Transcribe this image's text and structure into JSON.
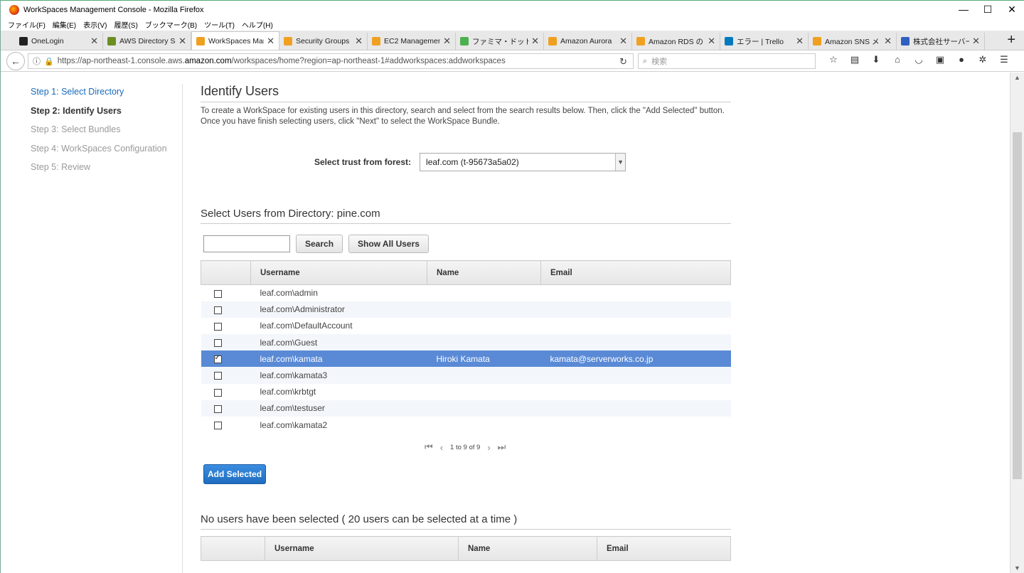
{
  "window": {
    "title": "WorkSpaces Management Console - Mozilla Firefox",
    "controls": [
      "—",
      "☐",
      "✕"
    ]
  },
  "menu": [
    "ファイル(F)",
    "編集(E)",
    "表示(V)",
    "履歴(S)",
    "ブックマーク(B)",
    "ツール(T)",
    "ヘルプ(H)"
  ],
  "tabs": [
    {
      "label": "OneLogin",
      "color": "#222222"
    },
    {
      "label": "AWS Directory Se",
      "color": "#6b8e23"
    },
    {
      "label": "WorkSpaces Man",
      "color": "#f0a020"
    },
    {
      "label": "Security Groups |",
      "color": "#f0a020"
    },
    {
      "label": "EC2 Managemen",
      "color": "#f0a020"
    },
    {
      "label": "ファミマ・ドット・コムL",
      "color": "#4cb050"
    },
    {
      "label": "Amazon Aurora",
      "color": "#f0a020"
    },
    {
      "label": "Amazon RDS の",
      "color": "#f0a020"
    },
    {
      "label": "エラー | Trello",
      "color": "#0079bf"
    },
    {
      "label": "Amazon SNS メ",
      "color": "#f0a020"
    },
    {
      "label": "株式会社サーバーワ",
      "color": "#3060c0"
    }
  ],
  "nav": {
    "url_prefix": "https://ap-northeast-1.console.aws.",
    "url_host": "amazon.com",
    "url_suffix": "/workspaces/home?region=ap-northeast-1#addworkspaces:addworkspaces",
    "search_placeholder": "検索"
  },
  "steps": [
    "Step 1: Select Directory",
    "Step 2: Identify Users",
    "Step 3: Select Bundles",
    "Step 4: WorkSpaces Configuration",
    "Step 5: Review"
  ],
  "main": {
    "title": "Identify Users",
    "description": "To create a WorkSpace for existing users in this directory, search and select from the search results below. Then, click the \"Add Selected\" button. Once you have finish selecting users, click \"Next\" to select the WorkSpace Bundle.",
    "forest_label": "Select trust from forest:",
    "forest_value": "leaf.com (t-95673a5a02)",
    "directory_heading": "Select Users from Directory: pine.com",
    "search_button": "Search",
    "show_all_button": "Show All Users",
    "columns": [
      "Username",
      "Name",
      "Email"
    ],
    "users": [
      {
        "username": "leaf.com\\admin",
        "name": "",
        "email": "",
        "checked": false
      },
      {
        "username": "leaf.com\\Administrator",
        "name": "",
        "email": "",
        "checked": false
      },
      {
        "username": "leaf.com\\DefaultAccount",
        "name": "",
        "email": "",
        "checked": false
      },
      {
        "username": "leaf.com\\Guest",
        "name": "",
        "email": "",
        "checked": false
      },
      {
        "username": "leaf.com\\kamata",
        "name": "Hiroki Kamata",
        "email": "kamata@serverworks.co.jp",
        "checked": true
      },
      {
        "username": "leaf.com\\kamata3",
        "name": "",
        "email": "",
        "checked": false
      },
      {
        "username": "leaf.com\\krbtgt",
        "name": "",
        "email": "",
        "checked": false
      },
      {
        "username": "leaf.com\\testuser",
        "name": "",
        "email": "",
        "checked": false
      },
      {
        "username": "leaf.com\\kamata2",
        "name": "",
        "email": "",
        "checked": false
      }
    ],
    "pagination": "1 to 9 of 9",
    "add_selected_button": "Add Selected",
    "selected_heading": "No users have been selected ( 20 users can be selected at a time )",
    "selected_columns": [
      "Username",
      "Name",
      "Email"
    ]
  },
  "colors": {
    "link": "#1a6ab8",
    "selected_row": "#5a8ad6",
    "primary_button": "#2a7ad0"
  }
}
